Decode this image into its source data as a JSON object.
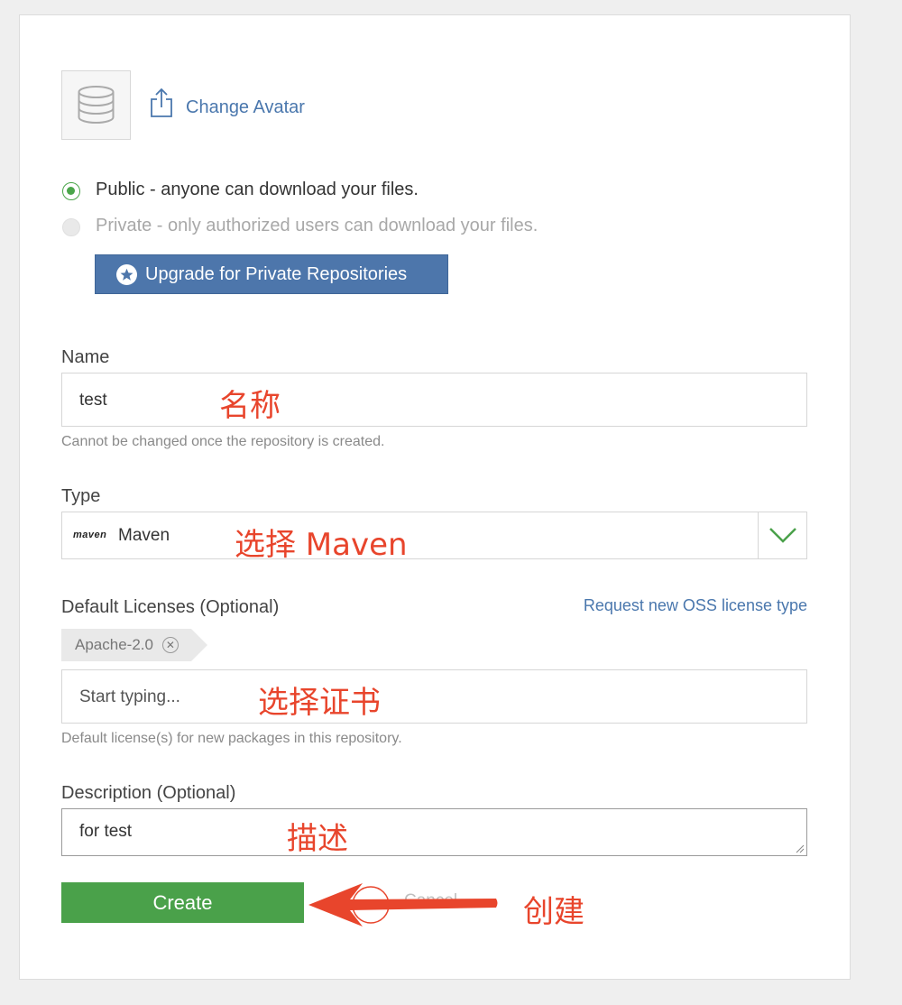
{
  "avatar": {
    "change_label": "Change Avatar"
  },
  "visibility": {
    "public_label": "Public - anyone can download your files.",
    "private_label": "Private - only authorized users can download your files.",
    "selected": "public",
    "upgrade_label": "Upgrade for Private Repositories"
  },
  "name_field": {
    "label": "Name",
    "value": "test",
    "help": "Cannot be changed once the repository is created.",
    "annotation": "名称"
  },
  "type_field": {
    "label": "Type",
    "logo_text": "maven",
    "value": "Maven",
    "annotation": "选择 Maven"
  },
  "licenses_field": {
    "label": "Default Licenses (Optional)",
    "request_link": "Request new OSS license type",
    "tags": [
      "Apache-2.0"
    ],
    "placeholder": "Start typing...",
    "help": "Default license(s) for new packages in this repository.",
    "annotation": "选择证书"
  },
  "description_field": {
    "label": "Description (Optional)",
    "value": "for test",
    "annotation": "描述"
  },
  "actions": {
    "create_label": "Create",
    "cancel_label": "Cancel",
    "annotation": "创建"
  },
  "colors": {
    "accent_blue": "#4d76ab",
    "create_green": "#4aa14a",
    "annotation_red": "#e8452c"
  }
}
